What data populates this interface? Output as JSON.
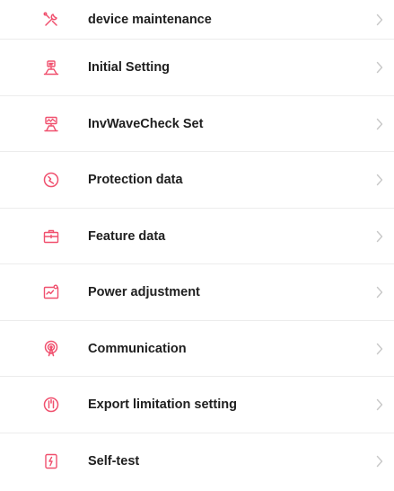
{
  "theme": {
    "accent": "#f0506e",
    "chevron": "#c8c8c8",
    "divider": "#ececec",
    "text": "#202020"
  },
  "menu": {
    "items": [
      {
        "label": "device maintenance",
        "icon": "tools-icon"
      },
      {
        "label": "Initial Setting",
        "icon": "initial-setting-icon"
      },
      {
        "label": "InvWaveCheck Set",
        "icon": "wave-check-icon"
      },
      {
        "label": "Protection data",
        "icon": "protection-icon"
      },
      {
        "label": "Feature data",
        "icon": "feature-icon"
      },
      {
        "label": "Power adjustment",
        "icon": "power-adjust-icon"
      },
      {
        "label": "Communication",
        "icon": "communication-icon"
      },
      {
        "label": "Export limitation setting",
        "icon": "export-limit-icon"
      },
      {
        "label": "Self-test",
        "icon": "self-test-icon"
      }
    ]
  }
}
